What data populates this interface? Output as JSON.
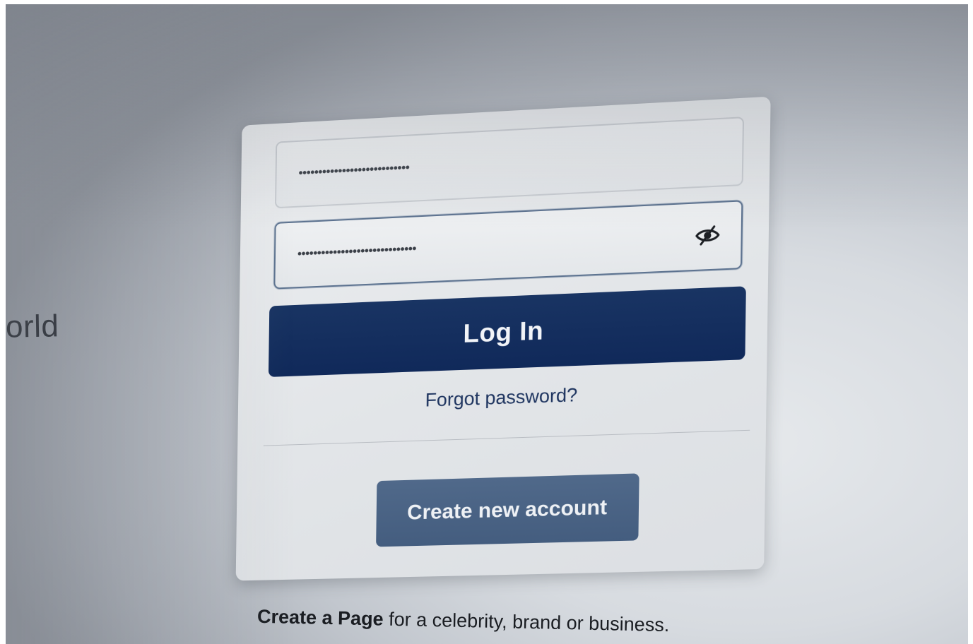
{
  "left_tagline_fragment": "orld",
  "login_form": {
    "email_value": "••••••••••••••••••••••••••••",
    "password_value": "••••••••••••••••••••••••••••••",
    "password_toggle_icon": "eye-slash-icon",
    "login_label": "Log In",
    "forgot_label": "Forgot password?",
    "create_account_label": "Create new account"
  },
  "page_note": {
    "link_text": "Create a Page",
    "rest_text": " for a celebrity, brand or business."
  },
  "colors": {
    "login_button": "#132d5e",
    "create_button": "#4a6385",
    "link": "#1f3560"
  }
}
